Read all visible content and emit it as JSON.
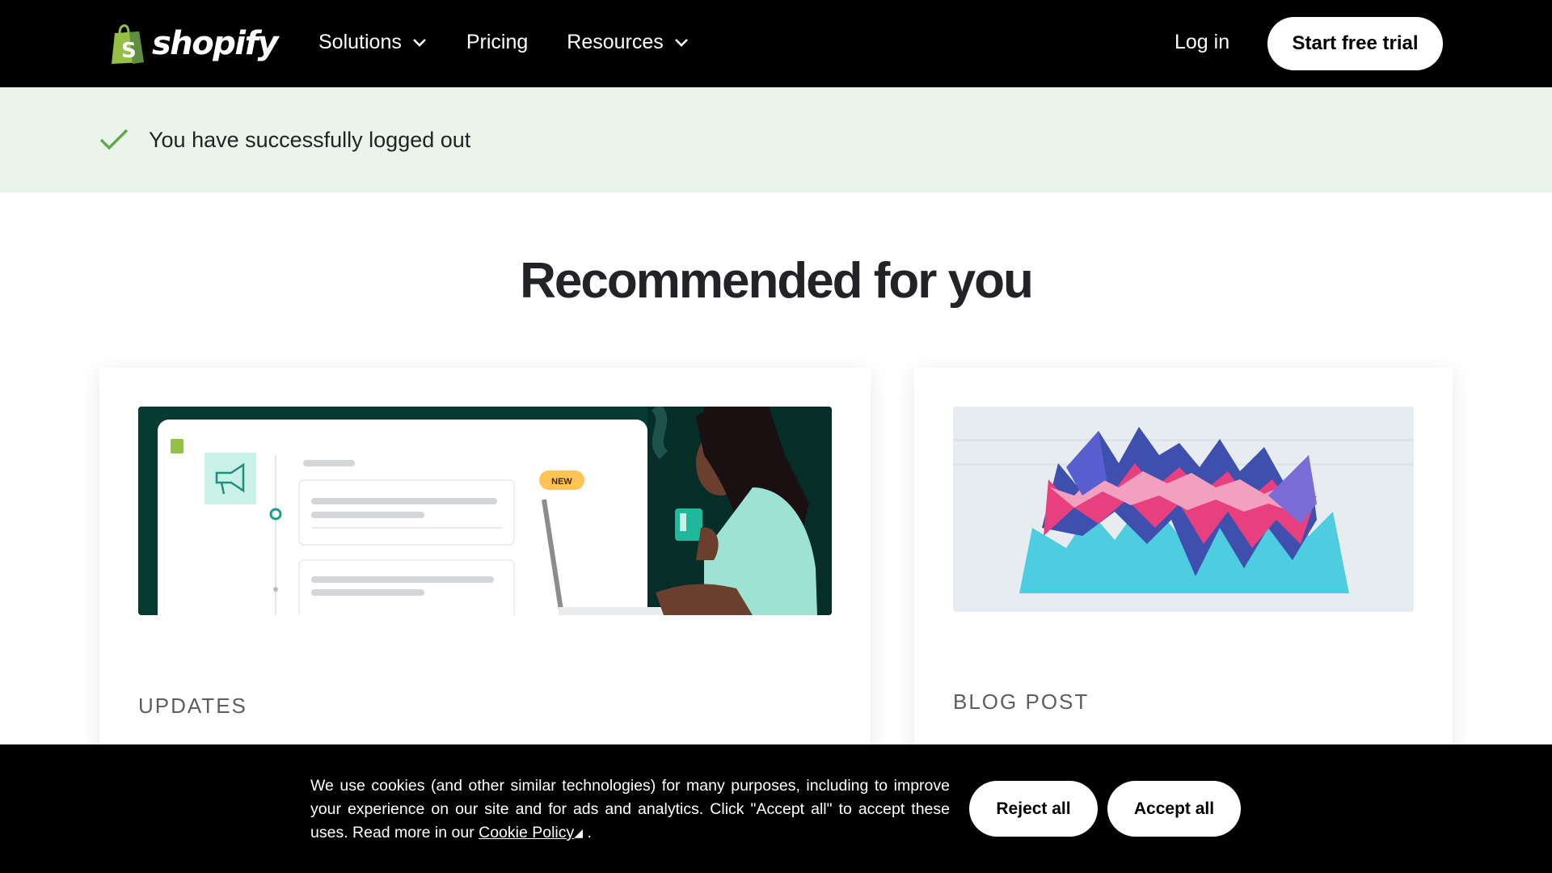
{
  "header": {
    "logo_text": "shopify",
    "nav": [
      {
        "label": "Solutions",
        "has_dropdown": true
      },
      {
        "label": "Pricing",
        "has_dropdown": false
      },
      {
        "label": "Resources",
        "has_dropdown": true
      }
    ],
    "login_label": "Log in",
    "cta_label": "Start free trial"
  },
  "banner": {
    "message": "You have successfully logged out",
    "icon": "checkmark-icon"
  },
  "main": {
    "heading": "Recommended for you",
    "cards": [
      {
        "eyebrow": "UPDATES",
        "image_badge": "NEW"
      },
      {
        "eyebrow": "BLOG POST"
      }
    ]
  },
  "cookie": {
    "text": "We use cookies (and other similar technologies) for many purposes, including to improve your experience on our site and for ads and analytics. Click \"Accept all\" to accept these uses. Read more in our",
    "link_label": "Cookie Policy",
    "trailing": ".",
    "reject_label": "Reject all",
    "accept_label": "Accept all"
  },
  "colors": {
    "header_bg": "#000000",
    "banner_bg": "#eaf4ea",
    "check": "#5fa84a",
    "brand_green": "#95bf47",
    "teal_dark": "#063b34",
    "teal_light": "#9de3d3"
  }
}
